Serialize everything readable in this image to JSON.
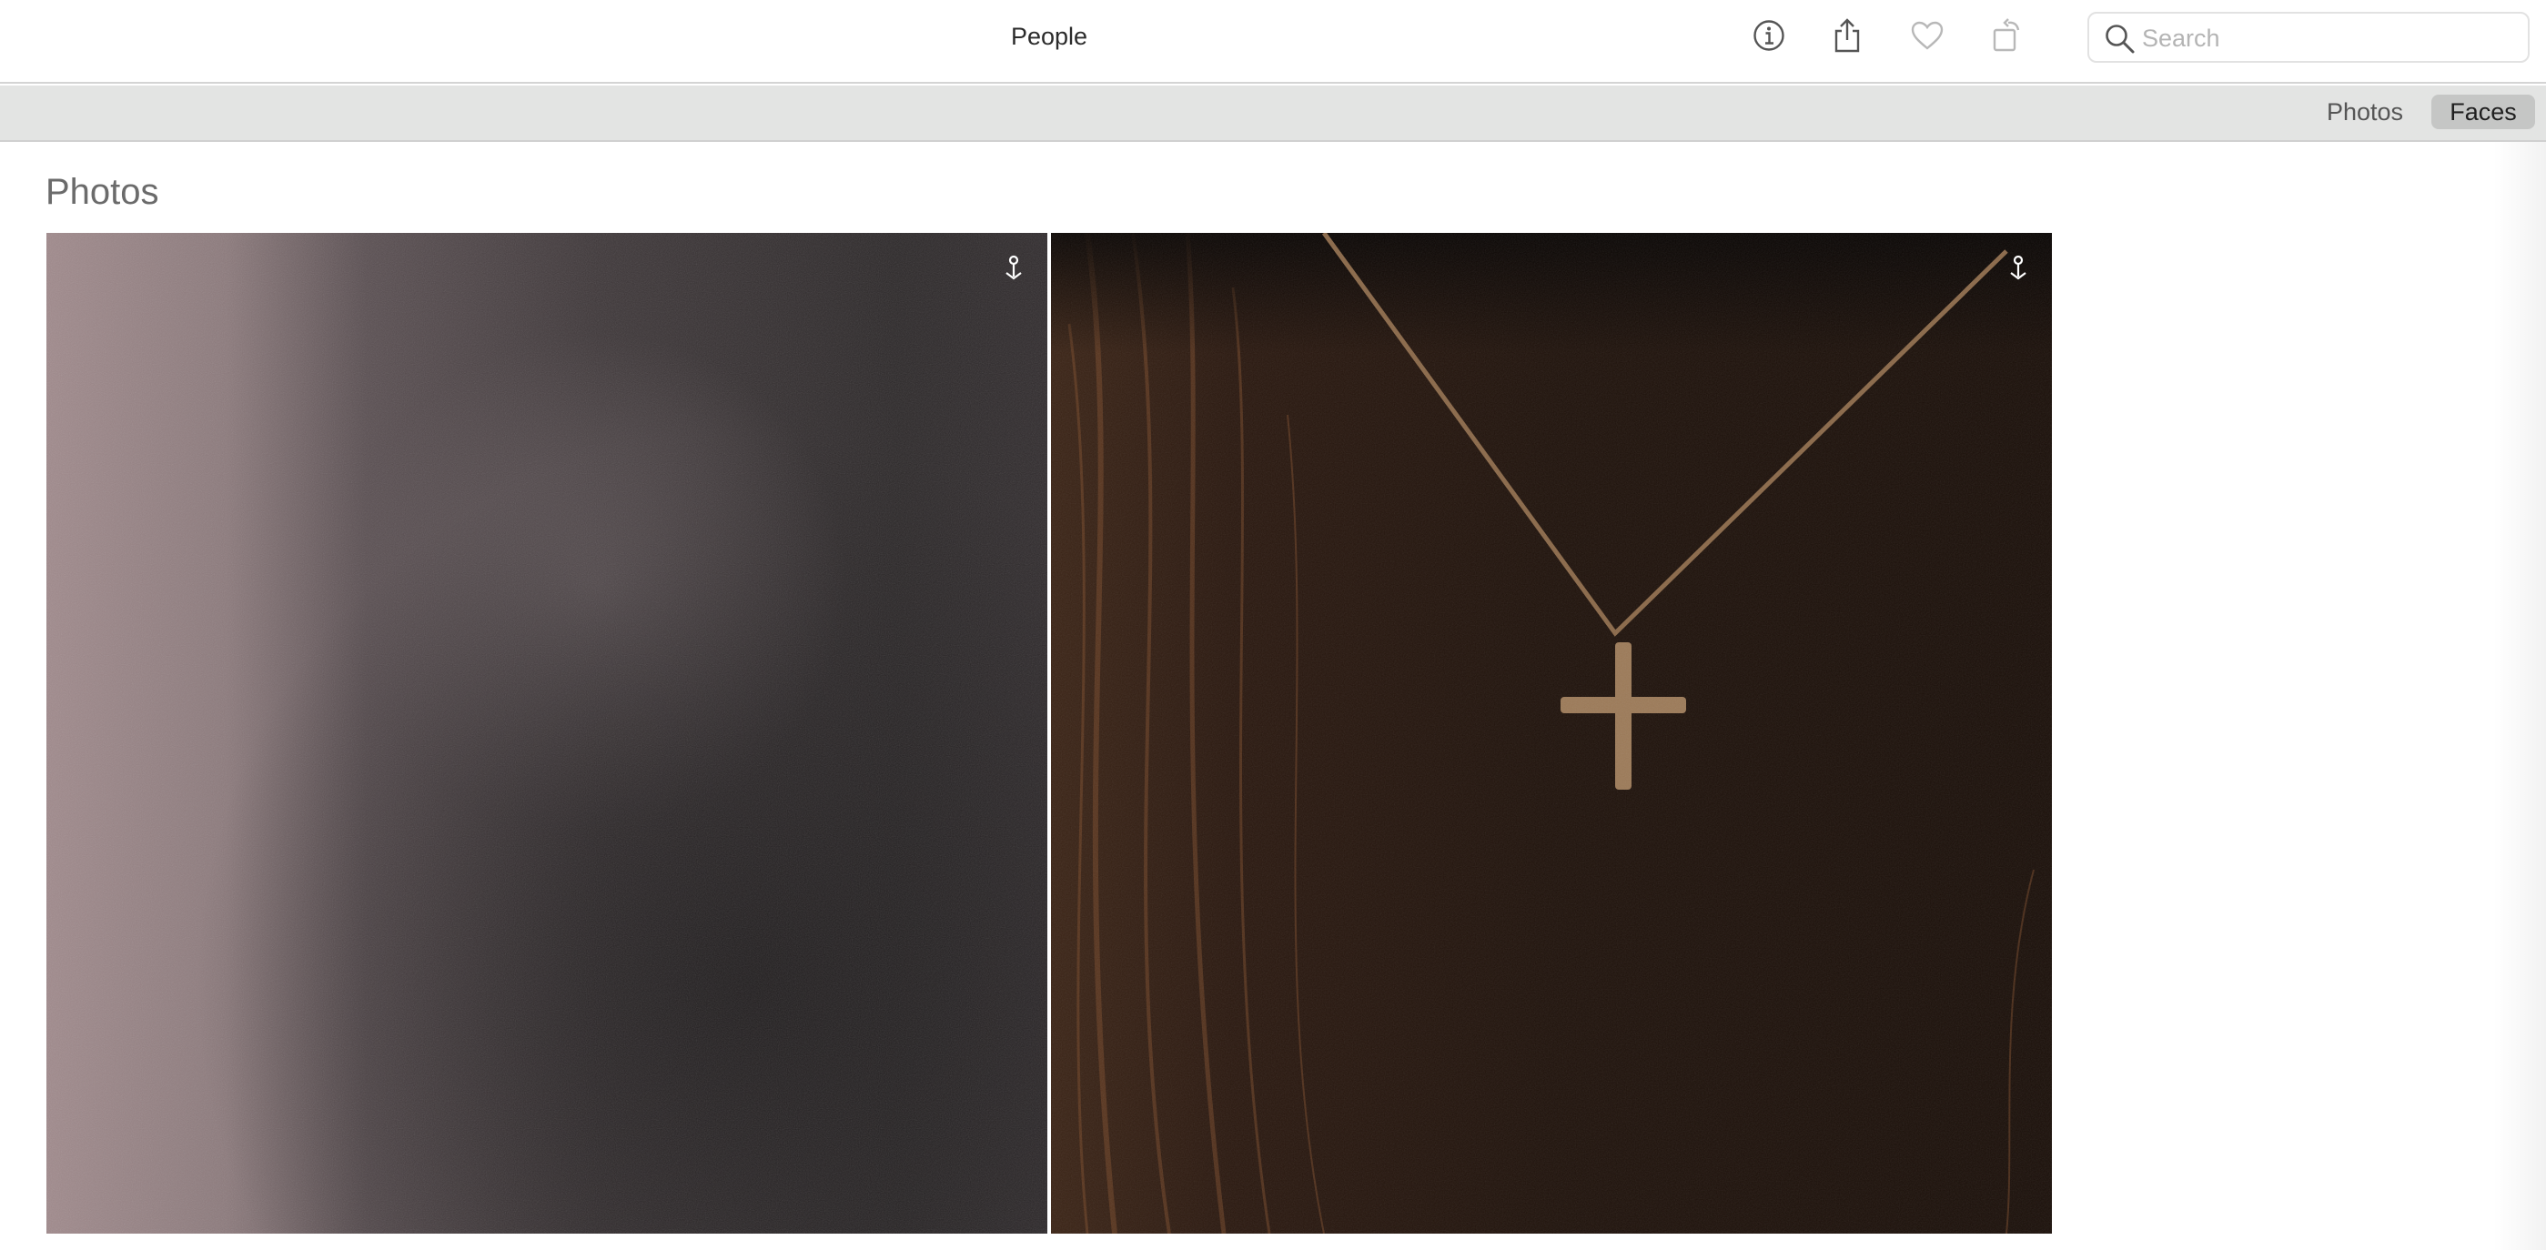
{
  "window": {
    "title": "People"
  },
  "toolbar": {
    "info_icon": "info-icon",
    "share_icon": "share-icon",
    "favorite_icon": "heart-icon",
    "rotate_icon": "rotate-icon"
  },
  "search": {
    "placeholder": "Search",
    "value": ""
  },
  "view_switcher": {
    "photos_label": "Photos",
    "faces_label": "Faces",
    "selected": "Faces"
  },
  "main": {
    "section_title": "Photos",
    "photos": [
      {
        "icon": "pin-icon"
      },
      {
        "icon": "pin-icon"
      }
    ]
  },
  "colors": {
    "accent_selected_segment": "#c5c6c5",
    "segment_bar": "#e3e4e3"
  }
}
